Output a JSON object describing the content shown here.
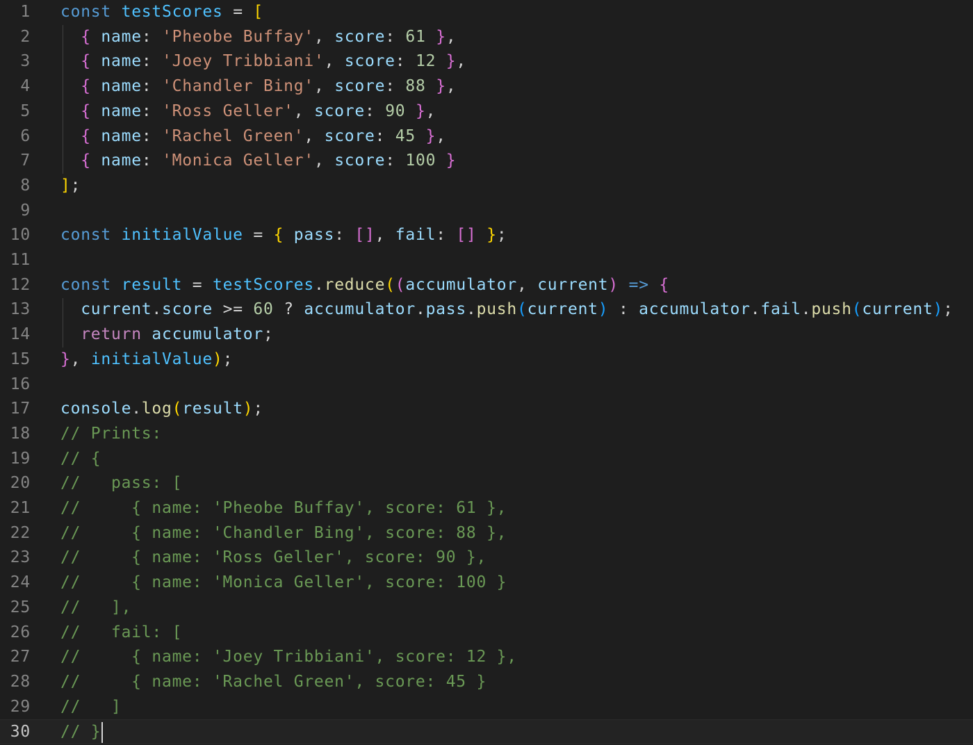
{
  "editor": {
    "active_line": 30,
    "colors": {
      "background": "#1e1e1e",
      "keyword": "#569cd6",
      "variable": "#4fc1ff",
      "property": "#9cdcfe",
      "string": "#ce9178",
      "number": "#b5cea8",
      "function": "#dcdcaa",
      "comment": "#6a9955",
      "control": "#c586c0",
      "bracket_level_1": "#ffd700",
      "bracket_level_2": "#da70d6",
      "bracket_level_3": "#179fff"
    },
    "lines": [
      {
        "number": "1",
        "tokens": [
          [
            "kw",
            "const"
          ],
          [
            "pun",
            " "
          ],
          [
            "var",
            "testScores"
          ],
          [
            "pun",
            " = "
          ],
          [
            "b1",
            "["
          ]
        ]
      },
      {
        "number": "2",
        "tokens": [
          [
            "pun",
            "  "
          ],
          [
            "b2",
            "{"
          ],
          [
            "pun",
            " "
          ],
          [
            "prop",
            "name"
          ],
          [
            "pun",
            ": "
          ],
          [
            "str",
            "'Pheobe Buffay'"
          ],
          [
            "pun",
            ", "
          ],
          [
            "prop",
            "score"
          ],
          [
            "pun",
            ": "
          ],
          [
            "num",
            "61"
          ],
          [
            "pun",
            " "
          ],
          [
            "b2",
            "}"
          ],
          [
            "pun",
            ","
          ]
        ]
      },
      {
        "number": "3",
        "tokens": [
          [
            "pun",
            "  "
          ],
          [
            "b2",
            "{"
          ],
          [
            "pun",
            " "
          ],
          [
            "prop",
            "name"
          ],
          [
            "pun",
            ": "
          ],
          [
            "str",
            "'Joey Tribbiani'"
          ],
          [
            "pun",
            ", "
          ],
          [
            "prop",
            "score"
          ],
          [
            "pun",
            ": "
          ],
          [
            "num",
            "12"
          ],
          [
            "pun",
            " "
          ],
          [
            "b2",
            "}"
          ],
          [
            "pun",
            ","
          ]
        ]
      },
      {
        "number": "4",
        "tokens": [
          [
            "pun",
            "  "
          ],
          [
            "b2",
            "{"
          ],
          [
            "pun",
            " "
          ],
          [
            "prop",
            "name"
          ],
          [
            "pun",
            ": "
          ],
          [
            "str",
            "'Chandler Bing'"
          ],
          [
            "pun",
            ", "
          ],
          [
            "prop",
            "score"
          ],
          [
            "pun",
            ": "
          ],
          [
            "num",
            "88"
          ],
          [
            "pun",
            " "
          ],
          [
            "b2",
            "}"
          ],
          [
            "pun",
            ","
          ]
        ]
      },
      {
        "number": "5",
        "tokens": [
          [
            "pun",
            "  "
          ],
          [
            "b2",
            "{"
          ],
          [
            "pun",
            " "
          ],
          [
            "prop",
            "name"
          ],
          [
            "pun",
            ": "
          ],
          [
            "str",
            "'Ross Geller'"
          ],
          [
            "pun",
            ", "
          ],
          [
            "prop",
            "score"
          ],
          [
            "pun",
            ": "
          ],
          [
            "num",
            "90"
          ],
          [
            "pun",
            " "
          ],
          [
            "b2",
            "}"
          ],
          [
            "pun",
            ","
          ]
        ]
      },
      {
        "number": "6",
        "tokens": [
          [
            "pun",
            "  "
          ],
          [
            "b2",
            "{"
          ],
          [
            "pun",
            " "
          ],
          [
            "prop",
            "name"
          ],
          [
            "pun",
            ": "
          ],
          [
            "str",
            "'Rachel Green'"
          ],
          [
            "pun",
            ", "
          ],
          [
            "prop",
            "score"
          ],
          [
            "pun",
            ": "
          ],
          [
            "num",
            "45"
          ],
          [
            "pun",
            " "
          ],
          [
            "b2",
            "}"
          ],
          [
            "pun",
            ","
          ]
        ]
      },
      {
        "number": "7",
        "tokens": [
          [
            "pun",
            "  "
          ],
          [
            "b2",
            "{"
          ],
          [
            "pun",
            " "
          ],
          [
            "prop",
            "name"
          ],
          [
            "pun",
            ": "
          ],
          [
            "str",
            "'Monica Geller'"
          ],
          [
            "pun",
            ", "
          ],
          [
            "prop",
            "score"
          ],
          [
            "pun",
            ": "
          ],
          [
            "num",
            "100"
          ],
          [
            "pun",
            " "
          ],
          [
            "b2",
            "}"
          ]
        ]
      },
      {
        "number": "8",
        "tokens": [
          [
            "b1",
            "]"
          ],
          [
            "pun",
            ";"
          ]
        ]
      },
      {
        "number": "9",
        "tokens": []
      },
      {
        "number": "10",
        "tokens": [
          [
            "kw",
            "const"
          ],
          [
            "pun",
            " "
          ],
          [
            "var",
            "initialValue"
          ],
          [
            "pun",
            " = "
          ],
          [
            "b1",
            "{"
          ],
          [
            "pun",
            " "
          ],
          [
            "prop",
            "pass"
          ],
          [
            "pun",
            ": "
          ],
          [
            "b2",
            "[]"
          ],
          [
            "pun",
            ", "
          ],
          [
            "prop",
            "fail"
          ],
          [
            "pun",
            ": "
          ],
          [
            "b2",
            "[]"
          ],
          [
            "pun",
            " "
          ],
          [
            "b1",
            "}"
          ],
          [
            "pun",
            ";"
          ]
        ]
      },
      {
        "number": "11",
        "tokens": []
      },
      {
        "number": "12",
        "tokens": [
          [
            "kw",
            "const"
          ],
          [
            "pun",
            " "
          ],
          [
            "var",
            "result"
          ],
          [
            "pun",
            " = "
          ],
          [
            "var",
            "testScores"
          ],
          [
            "pun",
            "."
          ],
          [
            "fn",
            "reduce"
          ],
          [
            "b1",
            "("
          ],
          [
            "b2",
            "("
          ],
          [
            "prop",
            "accumulator"
          ],
          [
            "pun",
            ", "
          ],
          [
            "prop",
            "current"
          ],
          [
            "b2",
            ")"
          ],
          [
            "pun",
            " "
          ],
          [
            "kw",
            "=>"
          ],
          [
            "pun",
            " "
          ],
          [
            "b2",
            "{"
          ]
        ]
      },
      {
        "number": "13",
        "tokens": [
          [
            "pun",
            "  "
          ],
          [
            "prop",
            "current"
          ],
          [
            "pun",
            "."
          ],
          [
            "prop",
            "score"
          ],
          [
            "pun",
            " >= "
          ],
          [
            "num",
            "60"
          ],
          [
            "pun",
            " ? "
          ],
          [
            "prop",
            "accumulator"
          ],
          [
            "pun",
            "."
          ],
          [
            "prop",
            "pass"
          ],
          [
            "pun",
            "."
          ],
          [
            "fn",
            "push"
          ],
          [
            "b3",
            "("
          ],
          [
            "prop",
            "current"
          ],
          [
            "b3",
            ")"
          ],
          [
            "pun",
            " : "
          ],
          [
            "prop",
            "accumulator"
          ],
          [
            "pun",
            "."
          ],
          [
            "prop",
            "fail"
          ],
          [
            "pun",
            "."
          ],
          [
            "fn",
            "push"
          ],
          [
            "b3",
            "("
          ],
          [
            "prop",
            "current"
          ],
          [
            "b3",
            ")"
          ],
          [
            "pun",
            ";"
          ]
        ]
      },
      {
        "number": "14",
        "tokens": [
          [
            "pun",
            "  "
          ],
          [
            "ctl",
            "return"
          ],
          [
            "pun",
            " "
          ],
          [
            "prop",
            "accumulator"
          ],
          [
            "pun",
            ";"
          ]
        ]
      },
      {
        "number": "15",
        "tokens": [
          [
            "b2",
            "}"
          ],
          [
            "pun",
            ", "
          ],
          [
            "var",
            "initialValue"
          ],
          [
            "b1",
            ")"
          ],
          [
            "pun",
            ";"
          ]
        ]
      },
      {
        "number": "16",
        "tokens": []
      },
      {
        "number": "17",
        "tokens": [
          [
            "prop",
            "console"
          ],
          [
            "pun",
            "."
          ],
          [
            "fn",
            "log"
          ],
          [
            "b1",
            "("
          ],
          [
            "prop",
            "result"
          ],
          [
            "b1",
            ")"
          ],
          [
            "pun",
            ";"
          ]
        ]
      },
      {
        "number": "18",
        "tokens": [
          [
            "cm",
            "// Prints:"
          ]
        ]
      },
      {
        "number": "19",
        "tokens": [
          [
            "cm",
            "// {"
          ]
        ]
      },
      {
        "number": "20",
        "tokens": [
          [
            "cm",
            "//   pass: ["
          ]
        ]
      },
      {
        "number": "21",
        "tokens": [
          [
            "cm",
            "//     { name: 'Pheobe Buffay', score: 61 },"
          ]
        ]
      },
      {
        "number": "22",
        "tokens": [
          [
            "cm",
            "//     { name: 'Chandler Bing', score: 88 },"
          ]
        ]
      },
      {
        "number": "23",
        "tokens": [
          [
            "cm",
            "//     { name: 'Ross Geller', score: 90 },"
          ]
        ]
      },
      {
        "number": "24",
        "tokens": [
          [
            "cm",
            "//     { name: 'Monica Geller', score: 100 }"
          ]
        ]
      },
      {
        "number": "25",
        "tokens": [
          [
            "cm",
            "//   ],"
          ]
        ]
      },
      {
        "number": "26",
        "tokens": [
          [
            "cm",
            "//   fail: ["
          ]
        ]
      },
      {
        "number": "27",
        "tokens": [
          [
            "cm",
            "//     { name: 'Joey Tribbiani', score: 12 },"
          ]
        ]
      },
      {
        "number": "28",
        "tokens": [
          [
            "cm",
            "//     { name: 'Rachel Green', score: 45 }"
          ]
        ]
      },
      {
        "number": "29",
        "tokens": [
          [
            "cm",
            "//   ]"
          ]
        ]
      },
      {
        "number": "30",
        "tokens": [
          [
            "cm",
            "// }"
          ]
        ]
      }
    ]
  }
}
